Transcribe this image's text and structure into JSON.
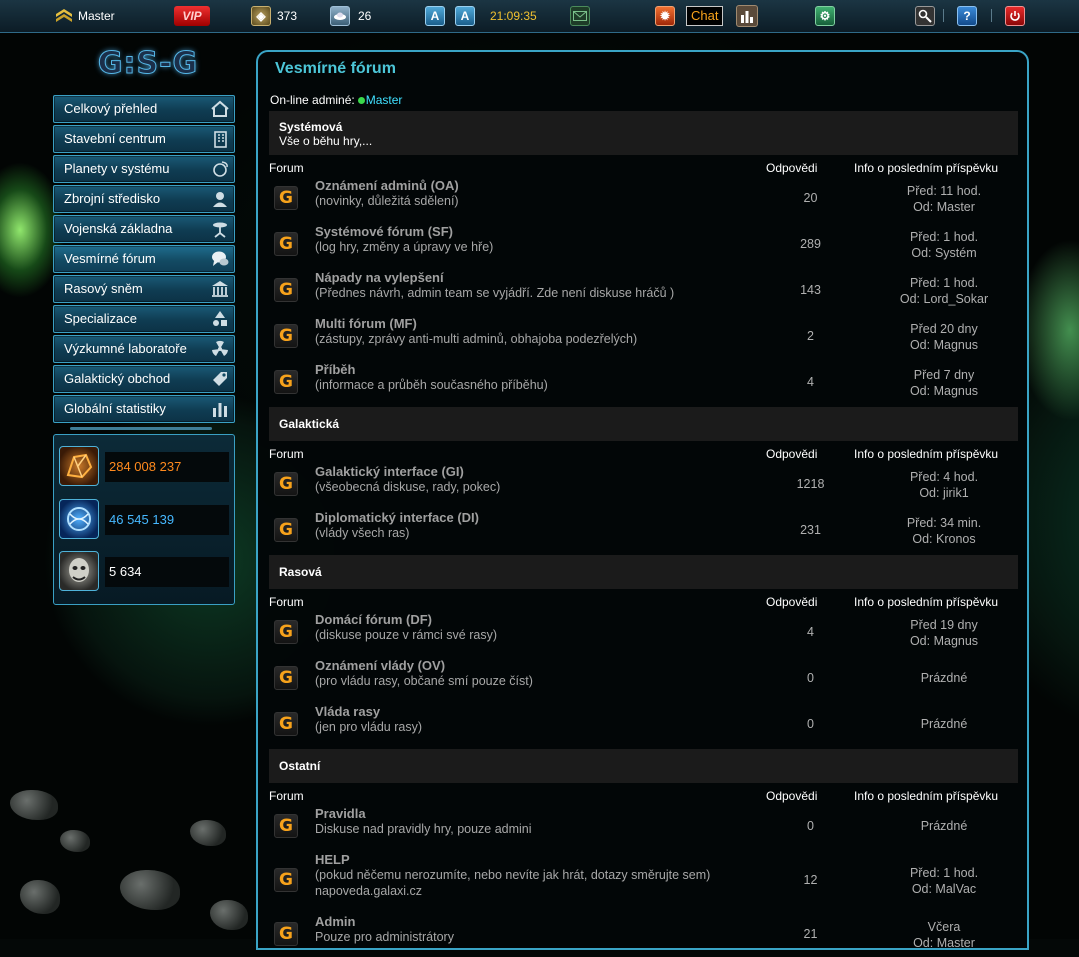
{
  "topbar": {
    "user": "Master",
    "vip": "VIP",
    "resource_a": "373",
    "resource_b": "26",
    "btn1": "A",
    "btn2": "A",
    "time": "21:09:35",
    "chat": "Chat",
    "help": "?"
  },
  "logo": "G:S-G",
  "nav": [
    {
      "label": "Celkový přehled",
      "icon": "home-icon"
    },
    {
      "label": "Stavební centrum",
      "icon": "building-icon"
    },
    {
      "label": "Planety v systému",
      "icon": "planet-icon"
    },
    {
      "label": "Zbrojní středisko",
      "icon": "soldier-icon"
    },
    {
      "label": "Vojenská základna",
      "icon": "base-icon"
    },
    {
      "label": "Vesmírné fórum",
      "icon": "chat-bubble-icon"
    },
    {
      "label": "Rasový sněm",
      "icon": "bank-icon"
    },
    {
      "label": "Specializace",
      "icon": "shapes-icon"
    },
    {
      "label": "Výzkumné laboratoře",
      "icon": "radiation-icon"
    },
    {
      "label": "Galaktický obchod",
      "icon": "tag-icon"
    },
    {
      "label": "Globální statistiky",
      "icon": "bar-chart-icon"
    }
  ],
  "resources": [
    {
      "value": "284 008 237",
      "color": "#ff8a1e",
      "icon": "ore-icon"
    },
    {
      "value": "46 545 139",
      "color": "#46b8ff",
      "icon": "energy-icon"
    },
    {
      "value": "5 634",
      "color": "#ffffff",
      "icon": "population-icon"
    }
  ],
  "forum": {
    "title": "Vesmírné fórum",
    "online_label": "On-line adminé:",
    "online_name": "Master",
    "col_forum": "Forum",
    "col_replies": "Odpovědi",
    "col_info": "Info o posledním příspěvku",
    "sections": [
      {
        "name": "Systémová",
        "desc": "Vše o běhu hry,...",
        "rows": [
          {
            "title": "Oznámení adminů (OA)",
            "desc": [
              "(novinky, důležitá sdělení)"
            ],
            "count": "20",
            "info": [
              "Před: 11 hod.",
              "Od: Master"
            ]
          },
          {
            "title": "Systémové fórum (SF)",
            "desc": [
              "(log hry, změny a úpravy ve hře)"
            ],
            "count": "289",
            "info": [
              "Před: 1 hod.",
              "Od: Systém"
            ]
          },
          {
            "title": "Nápady na vylepšení",
            "desc": [
              "(Přednes návrh, admin team se vyjádří. Zde není diskuse hráčů )"
            ],
            "count": "143",
            "info": [
              "Před: 1 hod.",
              "Od: Lord_Sokar"
            ]
          },
          {
            "title": "Multi fórum (MF)",
            "desc": [
              "(zástupy, zprávy anti-multi adminů, obhajoba podezřelých)"
            ],
            "count": "2",
            "info": [
              "Před 20 dny",
              "Od: Magnus"
            ]
          },
          {
            "title": "Příběh",
            "desc": [
              "(informace a průběh současného příběhu)"
            ],
            "count": "4",
            "info": [
              "Před 7 dny",
              "Od: Magnus"
            ]
          }
        ]
      },
      {
        "name": "Galaktická",
        "desc": "",
        "rows": [
          {
            "title": "Galaktický interface (GI)",
            "desc": [
              "(všeobecná diskuse, rady, pokec)"
            ],
            "count": "1218",
            "info": [
              "Před: 4 hod.",
              "Od: jirik1"
            ]
          },
          {
            "title": "Diplomatický interface (DI)",
            "desc": [
              "(vlády všech ras)"
            ],
            "count": "231",
            "info": [
              "Před: 34 min.",
              "Od: Kronos"
            ]
          }
        ]
      },
      {
        "name": "Rasová",
        "desc": "",
        "rows": [
          {
            "title": "Domácí fórum (DF)",
            "desc": [
              "(diskuse pouze v rámci své rasy)"
            ],
            "count": "4",
            "info": [
              "Před 19 dny",
              "Od: Magnus"
            ]
          },
          {
            "title": "Oznámení vlády (OV)",
            "desc": [
              "(pro vládu rasy, občané smí pouze číst)"
            ],
            "count": "0",
            "info": [
              "Prázdné"
            ]
          },
          {
            "title": "Vláda rasy",
            "desc": [
              "(jen pro vládu rasy)"
            ],
            "count": "0",
            "info": [
              "Prázdné"
            ]
          }
        ]
      },
      {
        "name": "Ostatní",
        "desc": "",
        "rows": [
          {
            "title": "Pravidla",
            "desc": [
              "Diskuse nad pravidly hry, pouze admini"
            ],
            "count": "0",
            "info": [
              "Prázdné"
            ]
          },
          {
            "title": "HELP",
            "desc": [
              "(pokud něčemu nerozumíte, nebo nevíte jak hrát, dotazy směrujte sem)",
              "napoveda.galaxi.cz"
            ],
            "count": "12",
            "info": [
              "Před: 1 hod.",
              "Od: MalVac"
            ]
          },
          {
            "title": "Admin",
            "desc": [
              "Pouze pro administrátory"
            ],
            "count": "21",
            "info": [
              "Včera",
              "Od: Master"
            ]
          }
        ]
      }
    ]
  }
}
